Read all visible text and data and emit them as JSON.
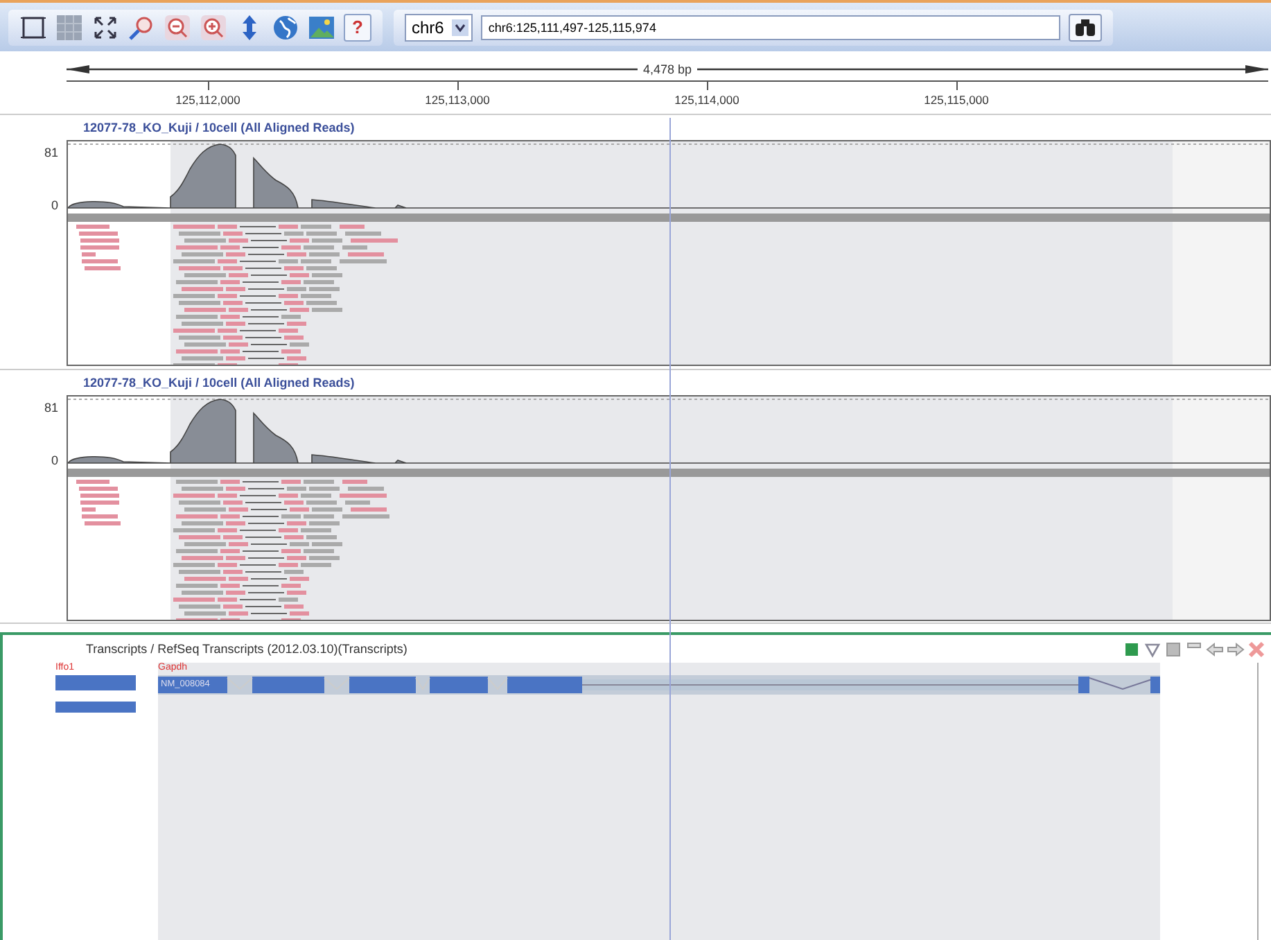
{
  "toolbar": {
    "help_button": "?",
    "chromosome": "chr6",
    "locus": "chr6:125,111,497-125,115,974"
  },
  "ruler": {
    "span": "4,478 bp",
    "ticks": [
      "125,112,000",
      "125,113,000",
      "125,114,000",
      "125,115,000"
    ]
  },
  "tracks": [
    {
      "title": "12077-78_KO_Kuji / 10cell (All Aligned Reads)",
      "y_max": "81",
      "y_min": "0"
    },
    {
      "title": "12077-78_KO_Kuji / 10cell (All Aligned Reads)",
      "y_max": "81",
      "y_min": "0"
    }
  ],
  "transcripts": {
    "title": "Transcripts / RefSeq Transcripts (2012.03.10)(Transcripts)",
    "genes": [
      {
        "name": "Iffo1"
      },
      {
        "name": "Gapdh",
        "transcript": "NM_008084"
      }
    ]
  }
}
